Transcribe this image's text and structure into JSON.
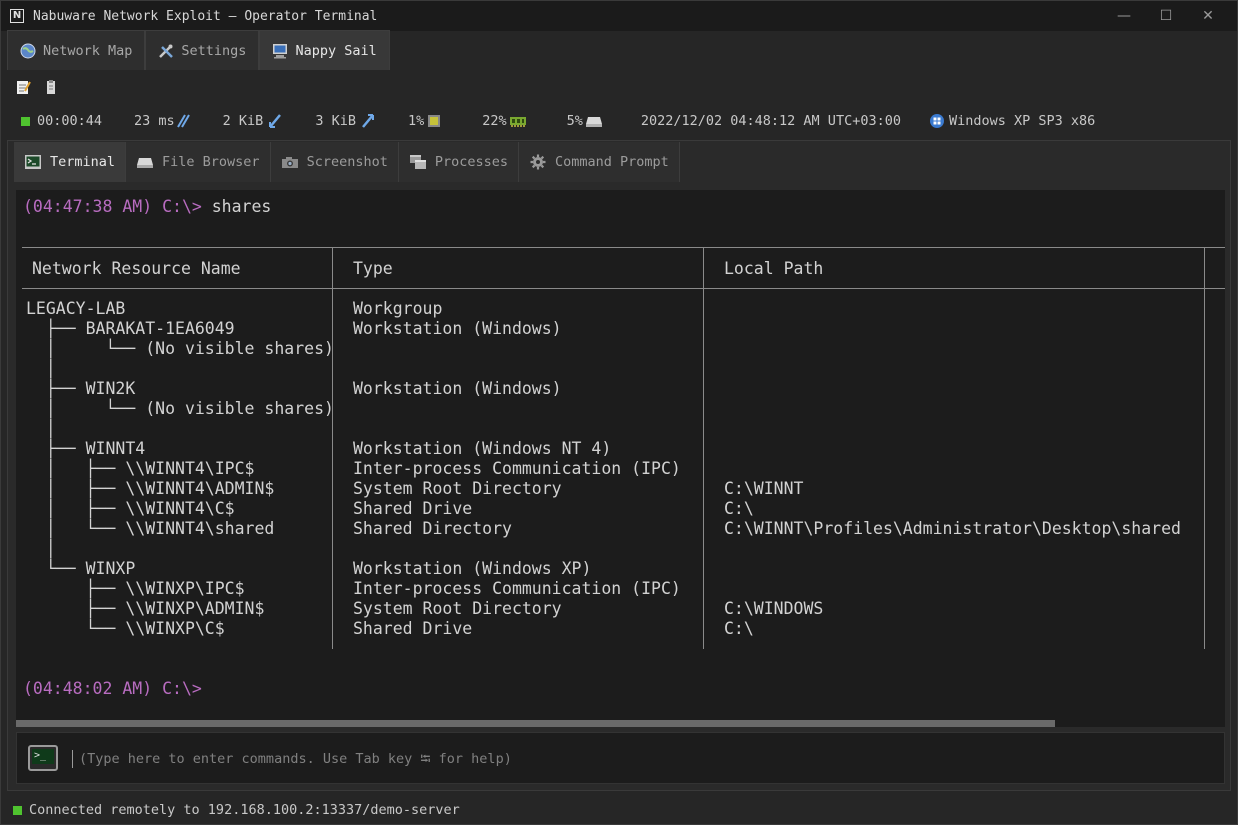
{
  "window": {
    "title": "Nabuware Network Exploit — Operator Terminal",
    "minimize_glyph": "—",
    "maximize_glyph": "☐",
    "close_glyph": "✕"
  },
  "top_tabs": [
    {
      "label": "Network Map",
      "icon": "globe-icon",
      "active": false
    },
    {
      "label": "Settings",
      "icon": "tools-icon",
      "active": false
    },
    {
      "label": "Nappy Sail",
      "icon": "computer-icon",
      "active": true
    }
  ],
  "toolbar": {
    "icons": [
      "notepad-icon",
      "clipboard-icon"
    ]
  },
  "status": {
    "uptime": "00:00:44",
    "latency": "23 ms",
    "download": "2 KiB",
    "upload": "3 KiB",
    "cpu": "1%",
    "memory": "22%",
    "disk": "5%",
    "datetime": "2022/12/02 04:48:12 AM UTC+03:00",
    "os": "Windows XP SP3 x86",
    "indicator_color": "#4fc32f"
  },
  "sub_tabs": [
    {
      "label": "Terminal",
      "icon": "terminal-icon",
      "active": true
    },
    {
      "label": "File Browser",
      "icon": "drive-icon",
      "active": false
    },
    {
      "label": "Screenshot",
      "icon": "camera-icon",
      "active": false
    },
    {
      "label": "Processes",
      "icon": "windows-stack-icon",
      "active": false
    },
    {
      "label": "Command Prompt",
      "icon": "gear-icon",
      "active": false
    }
  ],
  "terminal": {
    "first_prompt": "(04:47:38 AM) C:\\>",
    "first_command": " shares",
    "last_prompt": "(04:48:02 AM) C:\\>",
    "prompt_color": "#b86cc0",
    "columns": [
      "Network Resource Name",
      "Type",
      "Local Path"
    ],
    "rows": [
      {
        "name": "LEGACY-LAB",
        "type": "Workgroup",
        "path": ""
      },
      {
        "name": "  ├── BARAKAT-1EA6049",
        "type": "Workstation (Windows)",
        "path": ""
      },
      {
        "name": "  │     └── (No visible shares)",
        "type": "",
        "path": ""
      },
      {
        "name": "  │",
        "type": "",
        "path": ""
      },
      {
        "name": "  ├── WIN2K",
        "type": "Workstation (Windows)",
        "path": ""
      },
      {
        "name": "  │     └── (No visible shares)",
        "type": "",
        "path": ""
      },
      {
        "name": "  │",
        "type": "",
        "path": ""
      },
      {
        "name": "  ├── WINNT4",
        "type": "Workstation (Windows NT 4)",
        "path": ""
      },
      {
        "name": "  │   ├── \\\\WINNT4\\IPC$",
        "type": "Inter-process Communication (IPC)",
        "path": ""
      },
      {
        "name": "  │   ├── \\\\WINNT4\\ADMIN$",
        "type": "System Root Directory",
        "path": "C:\\WINNT"
      },
      {
        "name": "  │   ├── \\\\WINNT4\\C$",
        "type": "Shared Drive",
        "path": "C:\\"
      },
      {
        "name": "  │   └── \\\\WINNT4\\shared",
        "type": "Shared Directory",
        "path": "C:\\WINNT\\Profiles\\Administrator\\Desktop\\shared"
      },
      {
        "name": "  │",
        "type": "",
        "path": ""
      },
      {
        "name": "  └── WINXP",
        "type": "Workstation (Windows XP)",
        "path": ""
      },
      {
        "name": "      ├── \\\\WINXP\\IPC$",
        "type": "Inter-process Communication (IPC)",
        "path": ""
      },
      {
        "name": "      ├── \\\\WINXP\\ADMIN$",
        "type": "System Root Directory",
        "path": "C:\\WINDOWS"
      },
      {
        "name": "      └── \\\\WINXP\\C$",
        "type": "Shared Drive",
        "path": "C:\\"
      }
    ]
  },
  "command_input": {
    "value": "",
    "placeholder": "(Type here to enter commands. Use Tab key ⭾ for help)",
    "icon_glyph": ">_"
  },
  "footer": {
    "connection": "Connected remotely to 192.168.100.2:13337/demo-server"
  }
}
